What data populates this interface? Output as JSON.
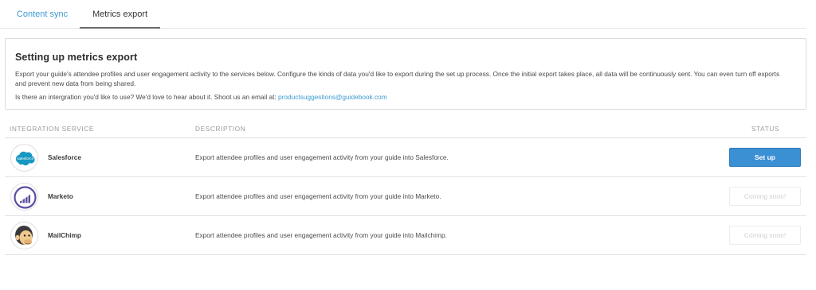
{
  "tabs": [
    {
      "label": "Content sync"
    },
    {
      "label": "Metrics export"
    }
  ],
  "info": {
    "title": "Setting up metrics export",
    "description": "Export your guide's attendee profiles and user engagement activity to the services below. Configure the kinds of data you'd like to export during the set up process. Once the initial export takes place, all data will be continuously sent. You can even turn off exports and prevent new data from being shared.",
    "contact_text": "Is there an intergration you'd like to use? We'd love to hear about it. Shoot us an email at:",
    "contact_email": "productsuggestions@guidebook.com"
  },
  "table": {
    "headers": {
      "service": "INTEGRATION SERVICE",
      "description": "DESCRIPTION",
      "status": "STATUS"
    },
    "rows": [
      {
        "name": "Salesforce",
        "logo_text": "salesforce",
        "description": "Export attendee profiles and user engagement activity from your guide into Salesforce.",
        "action": "Set up"
      },
      {
        "name": "Marketo",
        "description": "Export attendee profiles and user engagement activity from your guide into Marketo.",
        "action": "Coming soon!"
      },
      {
        "name": "MailChimp",
        "description": "Export attendee profiles and user engagement activity from your guide into Mailchimp.",
        "action": "Coming soon!"
      }
    ]
  },
  "colors": {
    "accent": "#3d9ad1",
    "button": "#3b8fd3",
    "salesforce": "#1798c1",
    "marketo": "#5c4c9f"
  },
  "icons": [
    "salesforce-logo-icon",
    "marketo-logo-icon",
    "mailchimp-logo-icon"
  ]
}
